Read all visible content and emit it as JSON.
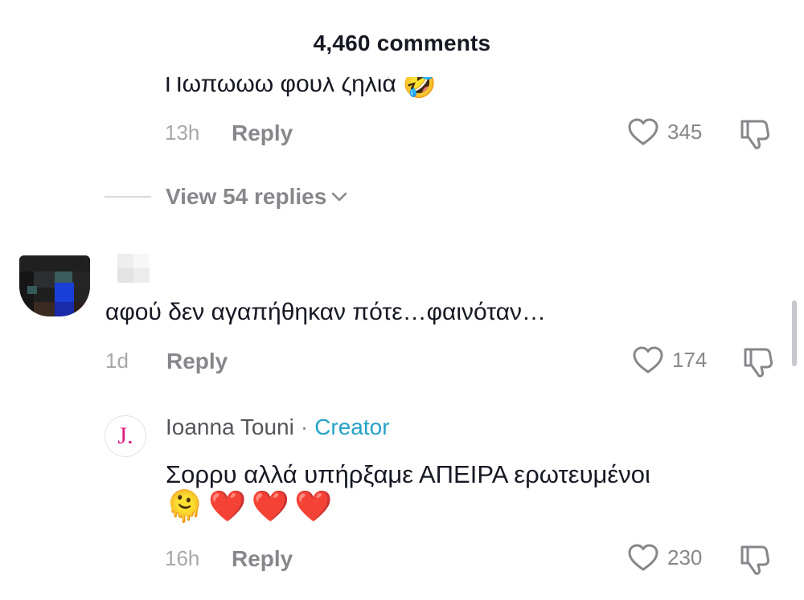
{
  "header": {
    "title": "4,460 comments"
  },
  "comment_top": {
    "text_partial": "Πωπωωω φουλ ζηλιά",
    "emoji": "🤣",
    "time": "13h",
    "reply_label": "Reply",
    "likes": "345"
  },
  "view_replies": {
    "label": "View 54 replies"
  },
  "comment_main": {
    "text": "αφού δεν αγαπήθηκαν πότε…φαινόταν…",
    "time": "1d",
    "reply_label": "Reply",
    "likes": "174"
  },
  "reply_creator": {
    "avatar_letter": "J.",
    "name": "Ioanna Touni",
    "separator": "·",
    "badge": "Creator",
    "text": "Σορρυ αλλά υπήρξαμε ΑΠΕΙΡΑ ερωτευμένοι",
    "emojis": [
      "🫠",
      "❤️",
      "❤️",
      "❤️"
    ],
    "time": "16h",
    "reply_label": "Reply",
    "likes": "230"
  },
  "colors": {
    "text_primary": "#161823",
    "text_secondary": "#86878b",
    "creator_badge": "#25a3c7",
    "avatar_letter": "#e0197d"
  },
  "icons": {
    "like": "heart-outline-icon",
    "dislike": "thumbs-down-outline-icon",
    "expand": "chevron-down-icon"
  }
}
